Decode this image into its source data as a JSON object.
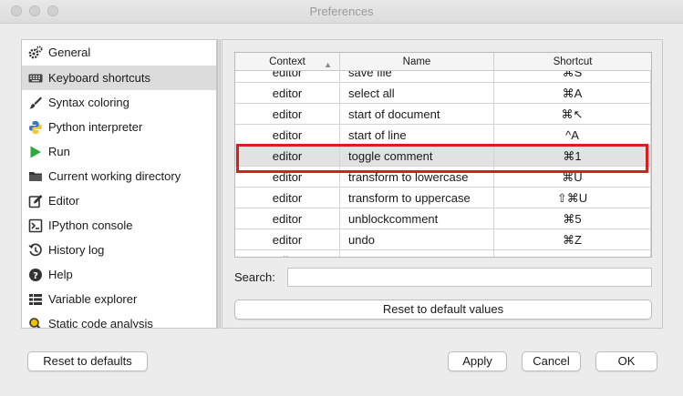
{
  "window": {
    "title": "Preferences"
  },
  "sidebar": {
    "items": [
      {
        "label": "General",
        "icon": "gear-icon"
      },
      {
        "label": "Keyboard shortcuts",
        "icon": "keyboard-icon",
        "selected": true
      },
      {
        "label": "Syntax coloring",
        "icon": "brush-icon"
      },
      {
        "label": "Python interpreter",
        "icon": "python-icon"
      },
      {
        "label": "Run",
        "icon": "play-icon"
      },
      {
        "label": "Current working directory",
        "icon": "folder-icon"
      },
      {
        "label": "Editor",
        "icon": "edit-icon"
      },
      {
        "label": "IPython console",
        "icon": "console-icon"
      },
      {
        "label": "History log",
        "icon": "history-icon"
      },
      {
        "label": "Help",
        "icon": "help-icon"
      },
      {
        "label": "Variable explorer",
        "icon": "grid-icon"
      },
      {
        "label": "Static code analysis",
        "icon": "analysis-icon"
      }
    ]
  },
  "table": {
    "columns": {
      "context": "Context",
      "name": "Name",
      "shortcut": "Shortcut"
    },
    "sort_indicator": "▲",
    "rows": [
      {
        "context": "editor",
        "name": "save file",
        "shortcut": "⌘S"
      },
      {
        "context": "editor",
        "name": "select all",
        "shortcut": "⌘A"
      },
      {
        "context": "editor",
        "name": "start of document",
        "shortcut": "⌘↖"
      },
      {
        "context": "editor",
        "name": "start of line",
        "shortcut": "^A"
      },
      {
        "context": "editor",
        "name": "toggle comment",
        "shortcut": "⌘1",
        "selected": true
      },
      {
        "context": "editor",
        "name": "transform to lowercase",
        "shortcut": "⌘U"
      },
      {
        "context": "editor",
        "name": "transform to uppercase",
        "shortcut": "⇧⌘U"
      },
      {
        "context": "editor",
        "name": "unblockcomment",
        "shortcut": "⌘5"
      },
      {
        "context": "editor",
        "name": "undo",
        "shortcut": "⌘Z"
      },
      {
        "context": "editor",
        "name": "",
        "shortcut": ""
      }
    ]
  },
  "search": {
    "label": "Search:",
    "value": "",
    "placeholder": ""
  },
  "buttons": {
    "reset_values": "Reset to default values",
    "reset_defaults": "Reset to defaults",
    "apply": "Apply",
    "cancel": "Cancel",
    "ok": "OK"
  },
  "colors": {
    "highlight": "#d81e1e",
    "selected_row": "#e2e2e2",
    "run_green": "#2eaa3c",
    "python_blue": "#3b78b4",
    "python_yellow": "#f5c631"
  }
}
